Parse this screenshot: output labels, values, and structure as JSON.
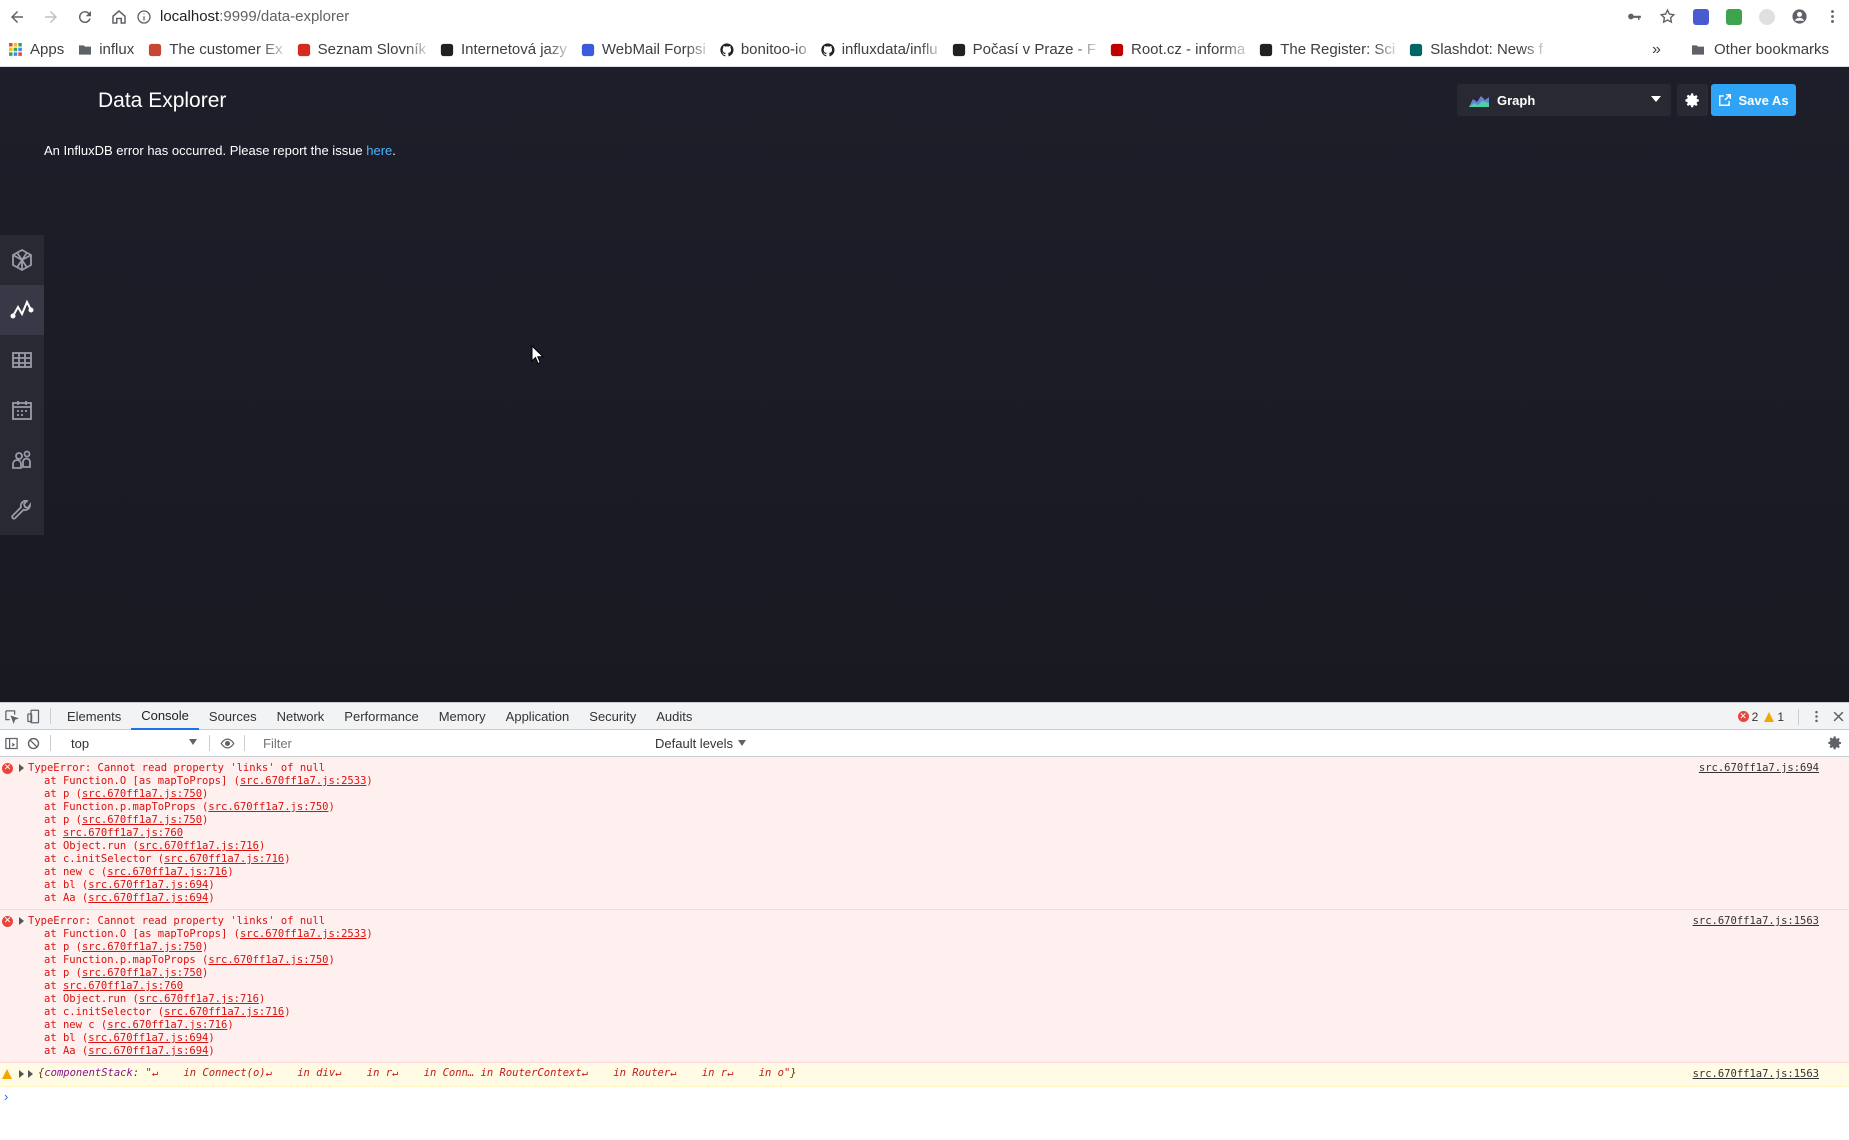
{
  "browser": {
    "url_host": "localhost",
    "url_path": ":9999/data-explorer",
    "bookmarks": [
      {
        "label": "Apps",
        "icon": "apps-grid-icon",
        "color": "#ea4335"
      },
      {
        "label": "influx",
        "icon": "folder-icon",
        "color": "#5f6368"
      },
      {
        "label": "The customer Ex",
        "icon": "oracle-icon",
        "color": "#c74634"
      },
      {
        "label": "Seznam Slovník",
        "icon": "seznam-icon",
        "color": "#d52b1e"
      },
      {
        "label": "Internetová jazy",
        "icon": "p-icon",
        "color": "#202124"
      },
      {
        "label": "WebMail Forpsi",
        "icon": "webmail-icon",
        "color": "#3b5bdb"
      },
      {
        "label": "bonitoo-io",
        "icon": "github-icon",
        "color": "#202124"
      },
      {
        "label": "influxdata/influ",
        "icon": "github-icon",
        "color": "#202124"
      },
      {
        "label": "Počasí v Praze - F",
        "icon": "weather-icon",
        "color": "#202124"
      },
      {
        "label": "Root.cz - informa",
        "icon": "root-icon",
        "color": "#c00000"
      },
      {
        "label": "The Register: Sci",
        "icon": "register-icon",
        "color": "#202124"
      },
      {
        "label": "Slashdot: News f",
        "icon": "slashdot-icon",
        "color": "#006666"
      }
    ],
    "more_label": "»",
    "other_bookmarks": "Other bookmarks"
  },
  "app": {
    "title": "Data Explorer",
    "error_prefix": "An InfluxDB error has occurred. Please report the issue ",
    "error_link": "here",
    "error_suffix": ".",
    "graph_select_label": "Graph",
    "save_label": "Save As",
    "accent_color": "#2fa3f5",
    "nav_icons": [
      "flux-logo-icon",
      "data-explorer-icon",
      "dashboards-icon",
      "tasks-icon",
      "organizations-icon",
      "settings-wrench-icon"
    ]
  },
  "devtools": {
    "tabs": [
      "Elements",
      "Console",
      "Sources",
      "Network",
      "Performance",
      "Memory",
      "Application",
      "Security",
      "Audits"
    ],
    "active_tab": "Console",
    "error_count": "2",
    "warning_count": "1",
    "context": "top",
    "filter_placeholder": "Filter",
    "levels_label": "Default levels",
    "entries": [
      {
        "message": "TypeError: Cannot read property 'links' of null",
        "source": "src.670ff1a7.js:694",
        "frames": [
          {
            "prefix": "at Function.O [as mapToProps] (",
            "link": "src.670ff1a7.js:2533",
            "suffix": ")"
          },
          {
            "prefix": "at p (",
            "link": "src.670ff1a7.js:750",
            "suffix": ")"
          },
          {
            "prefix": "at Function.p.mapToProps (",
            "link": "src.670ff1a7.js:750",
            "suffix": ")"
          },
          {
            "prefix": "at p (",
            "link": "src.670ff1a7.js:750",
            "suffix": ")"
          },
          {
            "prefix": "at ",
            "link": "src.670ff1a7.js:760",
            "suffix": ""
          },
          {
            "prefix": "at Object.run (",
            "link": "src.670ff1a7.js:716",
            "suffix": ")"
          },
          {
            "prefix": "at c.initSelector (",
            "link": "src.670ff1a7.js:716",
            "suffix": ")"
          },
          {
            "prefix": "at new c (",
            "link": "src.670ff1a7.js:716",
            "suffix": ")"
          },
          {
            "prefix": "at bl (",
            "link": "src.670ff1a7.js:694",
            "suffix": ")"
          },
          {
            "prefix": "at Aa (",
            "link": "src.670ff1a7.js:694",
            "suffix": ")"
          }
        ]
      },
      {
        "message": "TypeError: Cannot read property 'links' of null",
        "source": "src.670ff1a7.js:1563",
        "frames": [
          {
            "prefix": "at Function.O [as mapToProps] (",
            "link": "src.670ff1a7.js:2533",
            "suffix": ")"
          },
          {
            "prefix": "at p (",
            "link": "src.670ff1a7.js:750",
            "suffix": ")"
          },
          {
            "prefix": "at Function.p.mapToProps (",
            "link": "src.670ff1a7.js:750",
            "suffix": ")"
          },
          {
            "prefix": "at p (",
            "link": "src.670ff1a7.js:750",
            "suffix": ")"
          },
          {
            "prefix": "at ",
            "link": "src.670ff1a7.js:760",
            "suffix": ""
          },
          {
            "prefix": "at Object.run (",
            "link": "src.670ff1a7.js:716",
            "suffix": ")"
          },
          {
            "prefix": "at c.initSelector (",
            "link": "src.670ff1a7.js:716",
            "suffix": ")"
          },
          {
            "prefix": "at new c (",
            "link": "src.670ff1a7.js:716",
            "suffix": ")"
          },
          {
            "prefix": "at bl (",
            "link": "src.670ff1a7.js:694",
            "suffix": ")"
          },
          {
            "prefix": "at Aa (",
            "link": "src.670ff1a7.js:694",
            "suffix": ")"
          }
        ]
      }
    ],
    "warning": {
      "key": "componentStack",
      "value": "\"↵    in Connect(o)↵    in div↵    in r↵    in Conn… in RouterContext↵    in Router↵    in r↵    in o\"",
      "source": "src.670ff1a7.js:1563"
    },
    "prompt": "›"
  }
}
